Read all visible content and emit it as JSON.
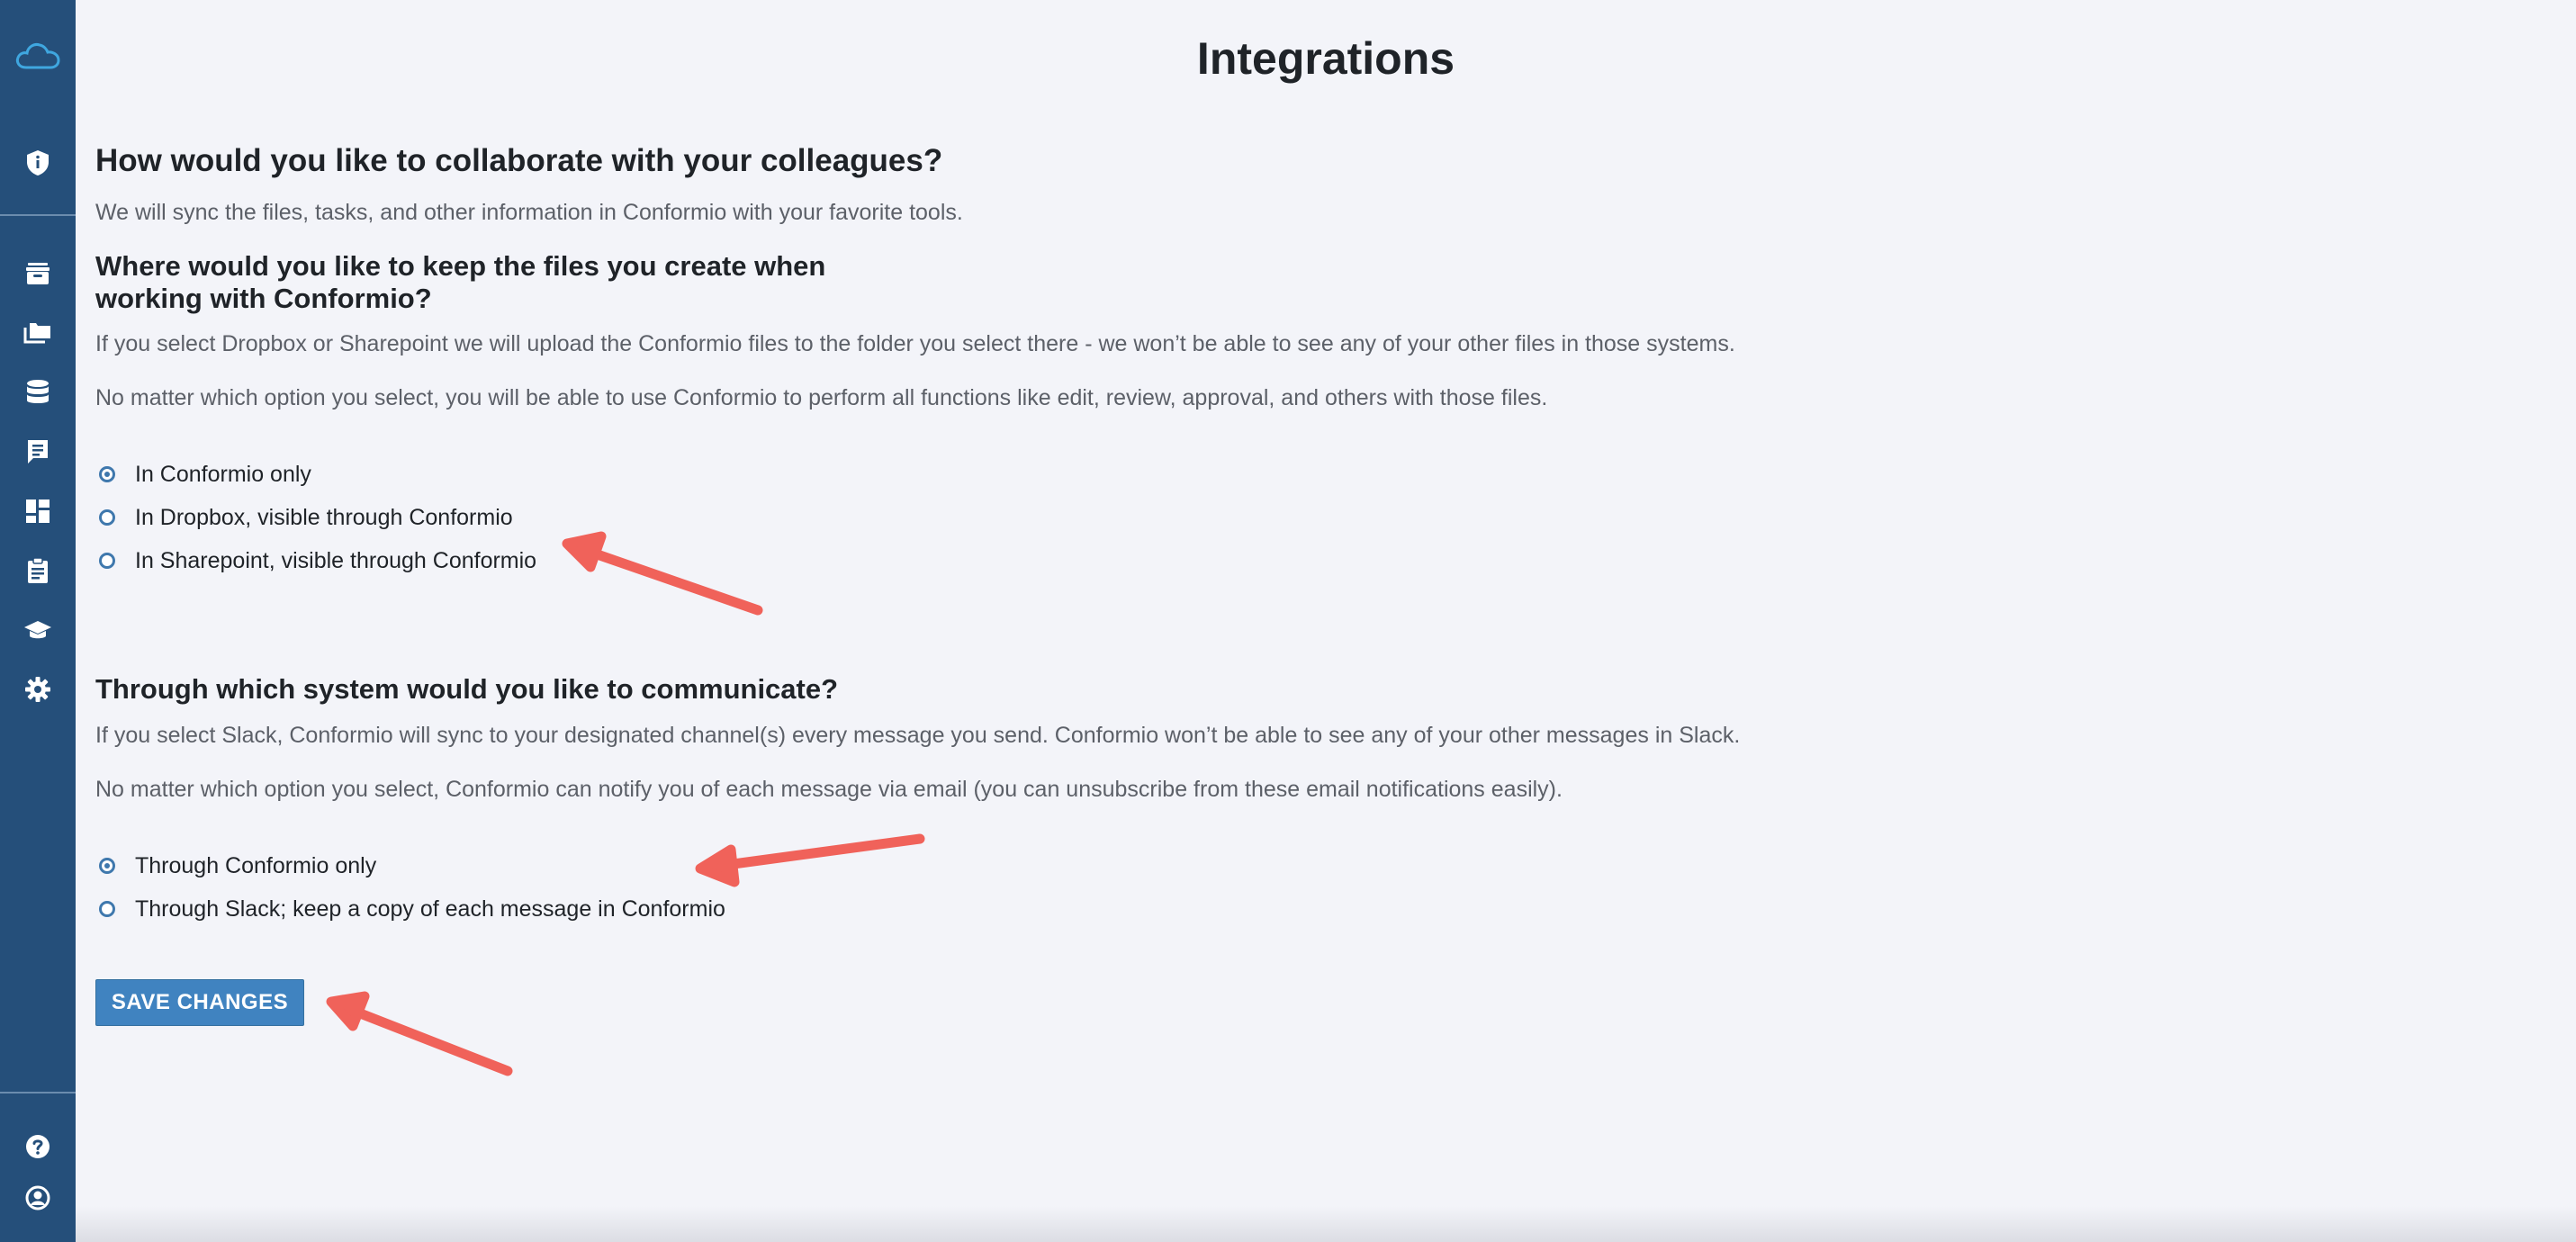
{
  "sidebar": {
    "logo_icon": "cloud-logo-icon",
    "top_items": [
      {
        "icon": "shield-info-icon"
      }
    ],
    "nav_items": [
      {
        "icon": "archive-icon"
      },
      {
        "icon": "folders-icon"
      },
      {
        "icon": "database-icon"
      },
      {
        "icon": "comments-icon"
      },
      {
        "icon": "dashboard-icon"
      },
      {
        "icon": "clipboard-icon"
      },
      {
        "icon": "graduation-cap-icon"
      },
      {
        "icon": "gear-icon"
      }
    ],
    "bottom_items": [
      {
        "icon": "help-icon"
      },
      {
        "icon": "user-account-icon"
      }
    ],
    "background": "#254f7a"
  },
  "page": {
    "title": "Integrations",
    "heading": "How would you like to collaborate with your colleagues?",
    "intro": "We will sync the files, tasks, and other information in Conformio with your favorite tools."
  },
  "files_section": {
    "heading_line1": "Where would you like to keep the files you create when",
    "heading_line2": "working with Conformio?",
    "para1": "If you select Dropbox or Sharepoint we will upload the Conformio files to the folder you select there - we won’t be able to see any of your other files in those systems.",
    "para2": "No matter which option you select, you will be able to use Conformio to perform all functions like edit, review, approval, and others with those files.",
    "options": [
      {
        "label": "In Conformio only",
        "checked": true
      },
      {
        "label": "In Dropbox, visible through Conformio",
        "checked": false
      },
      {
        "label": "In Sharepoint, visible through Conformio",
        "checked": false
      }
    ]
  },
  "comm_section": {
    "heading": "Through which system would you like to communicate?",
    "para1": "If you select Slack, Conformio will sync to your designated channel(s) every message you send. Conformio won’t be able to see any of your other messages in Slack.",
    "para2": "No matter which option you select, Conformio can notify you of each message via email (you can unsubscribe from these email notifications easily).",
    "options": [
      {
        "label": "Through Conformio only",
        "checked": true
      },
      {
        "label": "Through Slack; keep a copy of each message in Conformio",
        "checked": false
      }
    ]
  },
  "actions": {
    "save_label": "SAVE CHANGES"
  },
  "colors": {
    "accent": "#4083c0",
    "annotation_arrow": "#f0625a"
  }
}
